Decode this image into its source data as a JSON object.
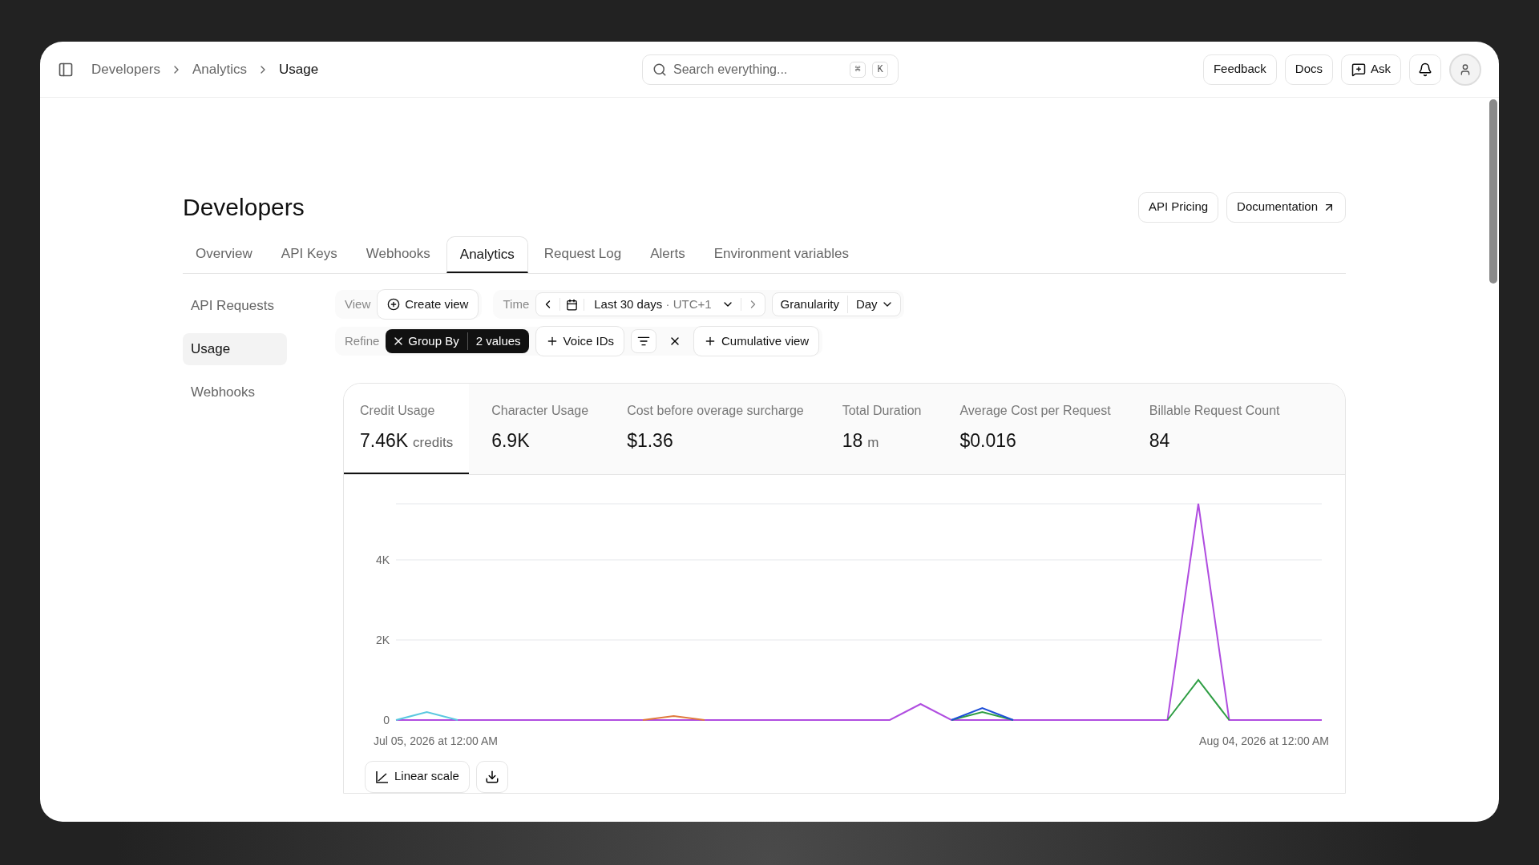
{
  "topbar": {
    "breadcrumbs": [
      {
        "label": "Developers",
        "selected": false
      },
      {
        "label": "Analytics",
        "selected": false
      },
      {
        "label": "Usage",
        "selected": true
      }
    ],
    "search": {
      "placeholder": "Search everything...",
      "keys": [
        "⌘",
        "K"
      ]
    },
    "buttons": [
      {
        "label": "Feedback",
        "kind": "plain"
      },
      {
        "label": "Docs",
        "kind": "plain"
      },
      {
        "label": "Ask",
        "kind": "ask"
      }
    ]
  },
  "page": {
    "title": "Developers",
    "header_buttons": [
      {
        "label": "API Pricing",
        "kind": "plain"
      },
      {
        "label": "Documentation",
        "kind": "external"
      }
    ],
    "tabs": [
      {
        "label": "Overview",
        "selected": false
      },
      {
        "label": "API Keys",
        "selected": false
      },
      {
        "label": "Webhooks",
        "selected": false
      },
      {
        "label": "Analytics",
        "selected": true
      },
      {
        "label": "Request Log",
        "selected": false
      },
      {
        "label": "Alerts",
        "selected": false
      },
      {
        "label": "Environment variables",
        "selected": false
      }
    ],
    "side_nav": [
      {
        "label": "API Requests",
        "selected": false
      },
      {
        "label": "Usage",
        "selected": true
      },
      {
        "label": "Webhooks",
        "selected": false
      }
    ],
    "filters": {
      "view": {
        "label": "View",
        "button": "Create view"
      },
      "time": {
        "label": "Time",
        "range": "Last 30 days",
        "zone": "· UTC+1"
      },
      "granularity": {
        "label": "Granularity",
        "value": "Day"
      },
      "refine": {
        "label": "Refine",
        "group_by": {
          "label": "Group By",
          "value": "2 values"
        },
        "voice_ids": "Voice IDs",
        "cumulative": "Cumulative view"
      }
    },
    "metrics": [
      {
        "label": "Credit Usage",
        "value": "7.46K",
        "unit": "credits",
        "selected": true
      },
      {
        "label": "Character Usage",
        "value": "6.9K",
        "selected": false
      },
      {
        "label": "Cost before overage surcharge",
        "value": "$1.36",
        "selected": false
      },
      {
        "label": "Total Duration",
        "value": "18",
        "unit": "m",
        "selected": false
      },
      {
        "label": "Average Cost per Request",
        "value": "$0.016",
        "selected": false
      },
      {
        "label": "Billable Request Count",
        "value": "84",
        "selected": false
      }
    ],
    "chart": {
      "x_start_label": "Jul 05, 2026 at 12:00 AM",
      "x_end_label": "Aug 04, 2026 at 12:00 AM",
      "chart_data": {
        "type": "line",
        "ylim": [
          0,
          5400
        ],
        "yticks": [
          {
            "value": 0,
            "label": "0"
          },
          {
            "value": 2000,
            "label": "2K"
          },
          {
            "value": 4000,
            "label": "4K"
          }
        ],
        "series": [
          {
            "color": "#b04de0",
            "values": [
              0,
              0,
              0,
              0,
              0,
              0,
              0,
              0,
              0,
              0,
              0,
              0,
              0,
              0,
              0,
              0,
              0,
              400,
              0,
              0,
              0,
              0,
              0,
              0,
              0,
              0,
              5400,
              0,
              0,
              0,
              0
            ]
          },
          {
            "color": "#5bc8e0",
            "values": [
              0,
              200,
              0,
              null,
              null,
              null,
              null,
              null,
              null,
              null,
              null,
              null,
              null,
              null,
              null,
              null,
              null,
              null,
              null,
              null,
              null,
              null,
              null,
              null,
              null,
              null,
              null,
              null,
              null,
              null,
              null
            ]
          },
          {
            "color": "#e0793c",
            "values": [
              null,
              null,
              null,
              null,
              null,
              null,
              null,
              null,
              0,
              100,
              0,
              null,
              null,
              null,
              null,
              null,
              null,
              null,
              null,
              null,
              null,
              null,
              null,
              null,
              null,
              null,
              null,
              null,
              null,
              null,
              null
            ]
          },
          {
            "color": "#2f9e44",
            "values": [
              null,
              null,
              null,
              null,
              null,
              null,
              null,
              null,
              null,
              null,
              null,
              null,
              null,
              null,
              null,
              null,
              null,
              null,
              0,
              200,
              0,
              null,
              null,
              null,
              null,
              0,
              1000,
              0,
              null,
              null,
              null
            ]
          },
          {
            "color": "#1d4ed8",
            "values": [
              null,
              null,
              null,
              null,
              null,
              null,
              null,
              null,
              null,
              null,
              null,
              null,
              null,
              null,
              null,
              null,
              null,
              null,
              0,
              300,
              0,
              null,
              null,
              null,
              null,
              null,
              null,
              null,
              null,
              null,
              null
            ]
          }
        ]
      },
      "scale_button": "Linear scale"
    }
  }
}
